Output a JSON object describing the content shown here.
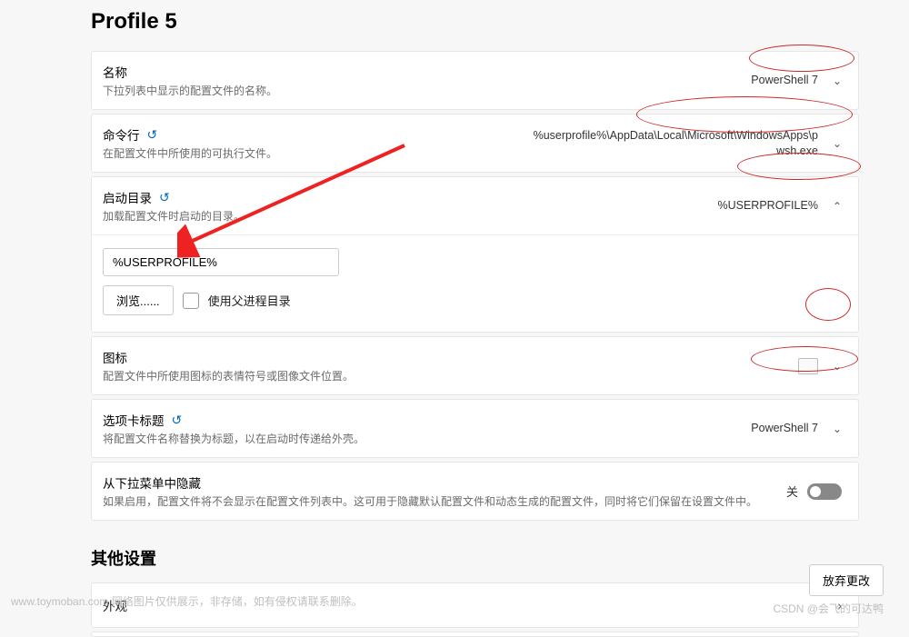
{
  "page": {
    "title": "Profile 5",
    "other_settings_heading": "其他设置"
  },
  "name": {
    "label": "名称",
    "desc": "下拉列表中显示的配置文件的名称。",
    "value": "PowerShell 7"
  },
  "commandline": {
    "label": "命令行",
    "desc": "在配置文件中所使用的可执行文件。",
    "value": "%userprofile%\\AppData\\Local\\Microsoft\\WindowsApps\\pwsh.exe"
  },
  "starting_dir": {
    "label": "启动目录",
    "desc": "加载配置文件时启动的目录。",
    "value": "%USERPROFILE%",
    "input_value": "%USERPROFILE%",
    "browse_label": "浏览......",
    "checkbox_label": "使用父进程目录"
  },
  "icon": {
    "label": "图标",
    "desc": "配置文件中所使用图标的表情符号或图像文件位置。"
  },
  "tab_title": {
    "label": "选项卡标题",
    "desc": "将配置文件名称替换为标题，以在启动时传递给外壳。",
    "value": "PowerShell 7"
  },
  "hide": {
    "label": "从下拉菜单中隐藏",
    "desc": "如果启用，配置文件将不会显示在配置文件列表中。这可用于隐藏默认配置文件和动态生成的配置文件，同时将它们保留在设置文件中。",
    "state_label": "关"
  },
  "appearance": {
    "label": "外观"
  },
  "buttons": {
    "discard": "放弃更改"
  },
  "watermark": {
    "left": "www.toymoban.com 网络图片仅供展示，非存储，如有侵权请联系删除。",
    "right": "CSDN @会飞的可达鸭"
  }
}
